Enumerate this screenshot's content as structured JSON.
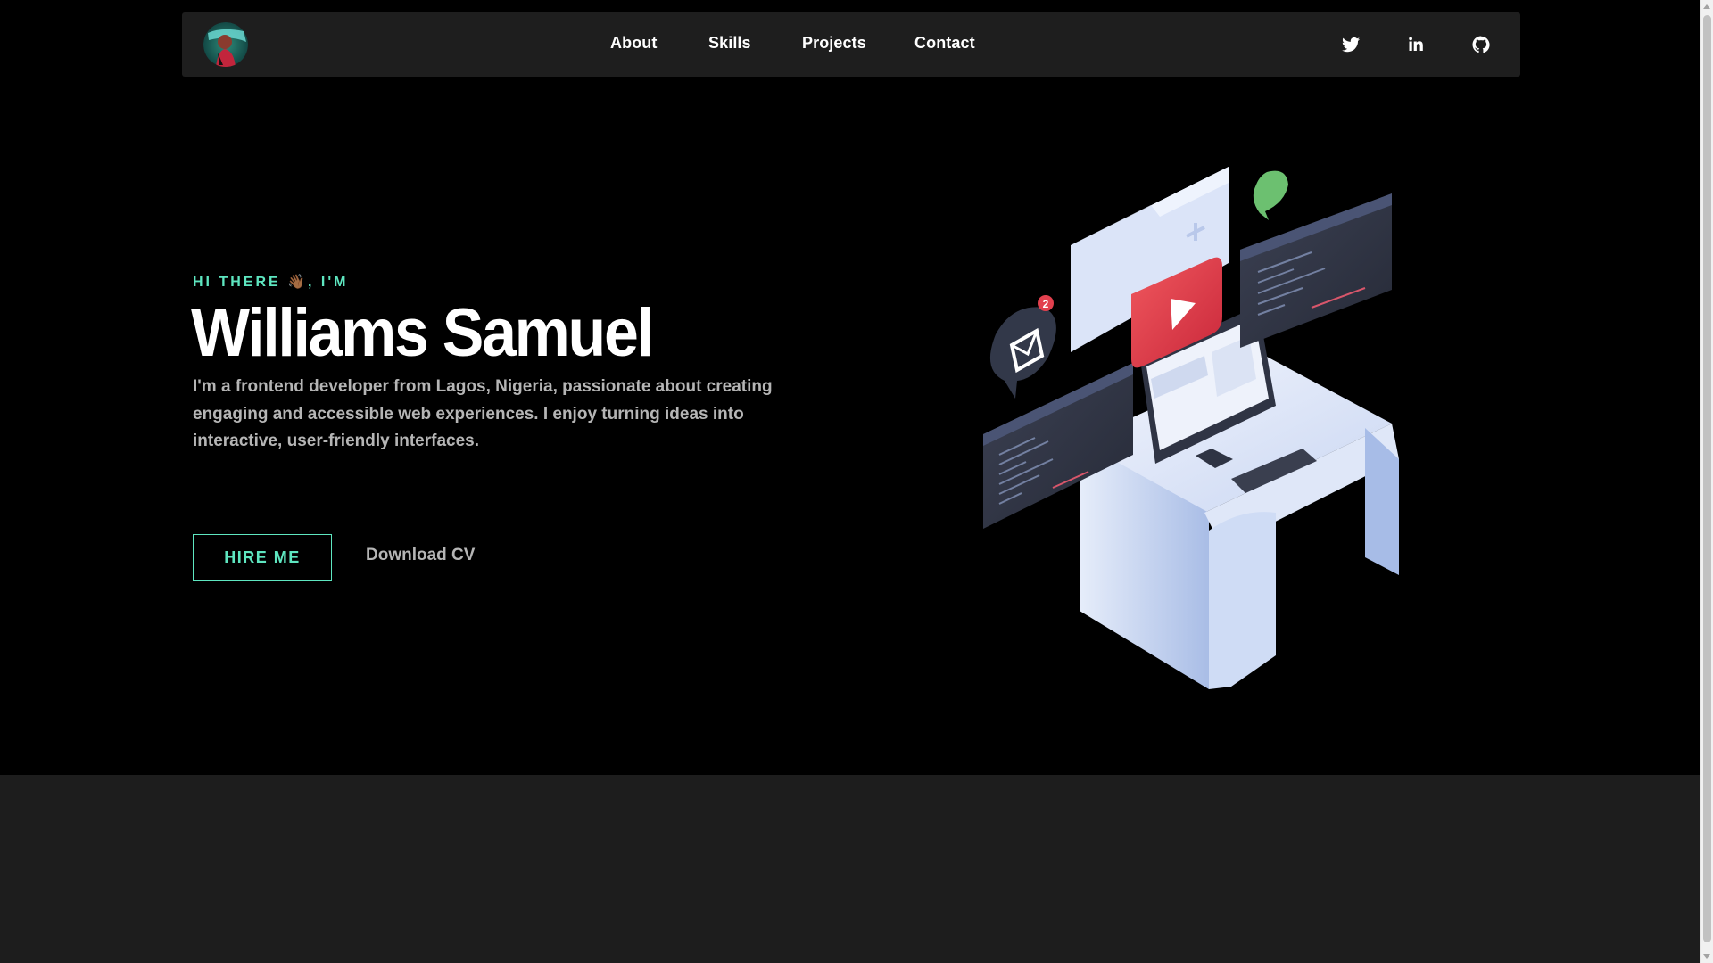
{
  "nav": {
    "links": [
      {
        "label": "About"
      },
      {
        "label": "Skills"
      },
      {
        "label": "Projects"
      },
      {
        "label": "Contact"
      }
    ],
    "socials": [
      {
        "name": "twitter-icon"
      },
      {
        "name": "linkedin-icon"
      },
      {
        "name": "github-icon"
      }
    ]
  },
  "hero": {
    "greeting": "HI THERE 👋🏾, I'M",
    "name": "Williams Samuel",
    "bio": "I'm a frontend developer from Lagos, Nigeria, passionate about creating engaging and accessible web experiences. I enjoy turning ideas into interactive, user-friendly interfaces.",
    "hire_label": "HIRE ME",
    "cv_label": "Download CV"
  },
  "illustration": {
    "notification_count": "2"
  },
  "colors": {
    "accent": "#5ee6c0",
    "navbar": "#1e1e1e",
    "lower_section": "#1d1d1d"
  }
}
